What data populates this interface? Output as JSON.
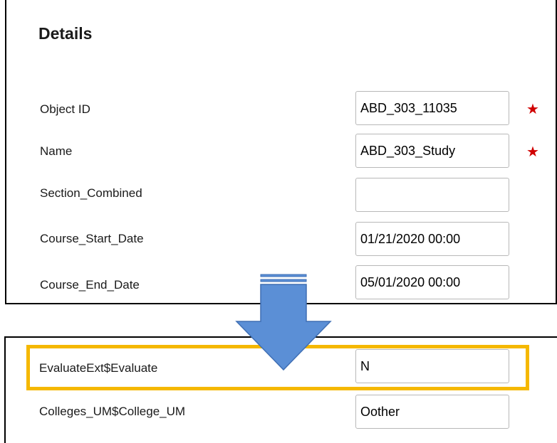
{
  "details": {
    "title": "Details",
    "fields": [
      {
        "label": "Object ID",
        "value": "ABD_303_11035",
        "required": true
      },
      {
        "label": "Name",
        "value": "ABD_303_Study",
        "required": true
      },
      {
        "label": "Section_Combined",
        "value": "",
        "required": false
      },
      {
        "label": "Course_Start_Date",
        "value": "01/21/2020 00:00",
        "required": false
      },
      {
        "label": "Course_End_Date",
        "value": "05/01/2020 00:00",
        "required": false
      }
    ],
    "required_marker": "★"
  },
  "extended": {
    "fields": [
      {
        "label": "EvaluateExt$Evaluate",
        "value": "N",
        "highlighted": true
      },
      {
        "label": "Colleges_UM$College_UM",
        "value": "Oother",
        "highlighted": false
      }
    ]
  },
  "colors": {
    "highlight": "#f5b800",
    "arrow_fill": "#5b8fd6",
    "arrow_stroke": "#3f6fb4",
    "required": "#d00000"
  }
}
